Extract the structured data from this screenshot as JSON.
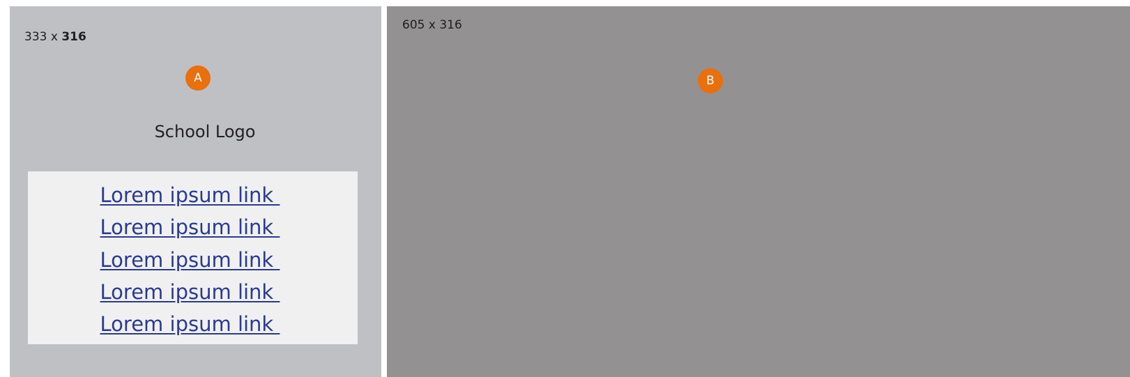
{
  "panel_a": {
    "dims_width": "333",
    "dims_sep": " x ",
    "dims_height": "316",
    "marker": "A",
    "logo_label": "School Logo",
    "links": [
      "Lorem ipsum link ",
      "Lorem ipsum link ",
      "Lorem ipsum link ",
      "Lorem ipsum link ",
      "Lorem ipsum link "
    ]
  },
  "panel_b": {
    "dims": "605 x 316",
    "marker": "B"
  },
  "colors": {
    "panel_a_bg": "#bfc0c4",
    "panel_b_bg": "#939192",
    "marker_bg": "#e8700d",
    "links_box_bg": "#f0f0f0",
    "link_color": "#2a3a92"
  }
}
